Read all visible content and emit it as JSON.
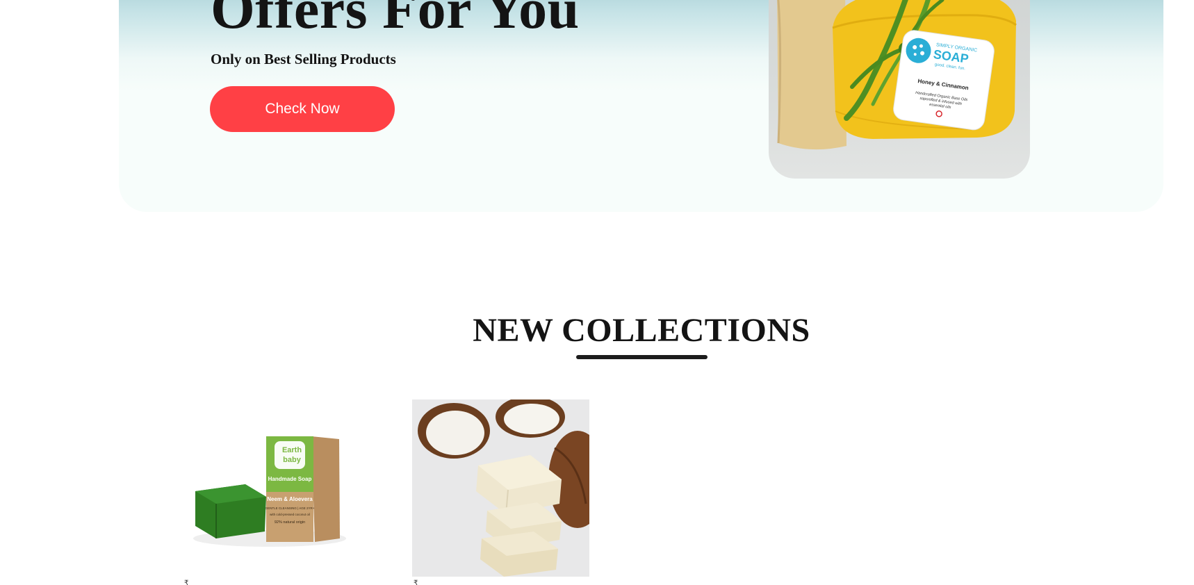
{
  "hero": {
    "title": "Offers For You",
    "subtitle": "Only on Best Selling Products",
    "button_label": "Check Now",
    "image": {
      "brand_line": "SIMPLY ORGANIC",
      "product_name": "SOAP",
      "tagline": "good. clean. fun.",
      "variant": "Honey & Cinnamon",
      "description_line_1": "Handcrafted Organic Base Oils",
      "description_line_2": "saponified & infused with",
      "description_line_3": "essential oils"
    }
  },
  "collections": {
    "title": "NEW COLLECTIONS",
    "products": [
      {
        "image_name": "earth-baby-neem-aloevera-soap",
        "box_brand_line_1": "Earth",
        "box_brand_line_2": "baby",
        "box_type": "Handmade Soap",
        "box_variant": "Neem & Aloevera",
        "box_detail_1": "GENTLE CLEANSING | AGE 2YR+",
        "box_detail_2": "with cold-pressed coconut oil",
        "box_detail_3": "92% natural origin",
        "price_stub": "₹"
      },
      {
        "image_name": "coconut-soap-bars",
        "price_stub": "₹"
      }
    ]
  },
  "colors": {
    "accent_button": "#ff4045",
    "title_text": "#141414",
    "hero_gradient_top": "#9ec9d1",
    "hero_gradient_bottom": "#f7fdfb"
  }
}
